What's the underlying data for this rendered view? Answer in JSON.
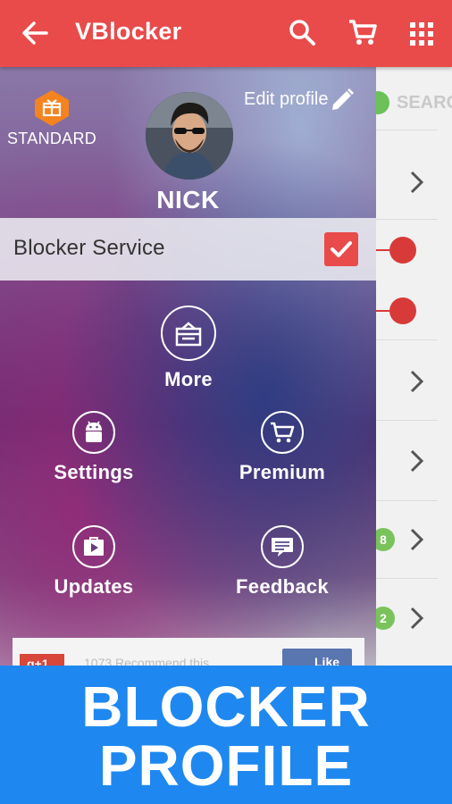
{
  "app": {
    "title": "VBlocker"
  },
  "appbar": {
    "back_icon": "back-arrow-icon",
    "search_icon": "search-icon",
    "cart_icon": "cart-icon",
    "grid_icon": "grid-apps-icon"
  },
  "background": {
    "search_label": "SEARC",
    "badges": [
      "8",
      "2"
    ]
  },
  "drawer": {
    "membership_label": "STANDARD",
    "edit_profile_label": "Edit profile",
    "username": "NICK",
    "service": {
      "label": "Blocker Service",
      "checked": true
    },
    "menu": [
      {
        "id": "more",
        "label": "More",
        "icon": "gift-box-icon"
      },
      {
        "id": "settings",
        "label": "Settings",
        "icon": "android-icon"
      },
      {
        "id": "premium",
        "label": "Premium",
        "icon": "cart-icon"
      },
      {
        "id": "updates",
        "label": "Updates",
        "icon": "play-store-icon"
      },
      {
        "id": "feedback",
        "label": "Feedback",
        "icon": "feedback-icon"
      }
    ],
    "social": {
      "gplus_label": "g+1",
      "text": "1073 Recommend this",
      "fb_label": "Like"
    }
  },
  "banner": {
    "line1": "BLOCKER",
    "line2": "PROFILE"
  },
  "colors": {
    "primary": "#e94a4a",
    "banner": "#1e88f0",
    "badge": "#f5831f"
  }
}
